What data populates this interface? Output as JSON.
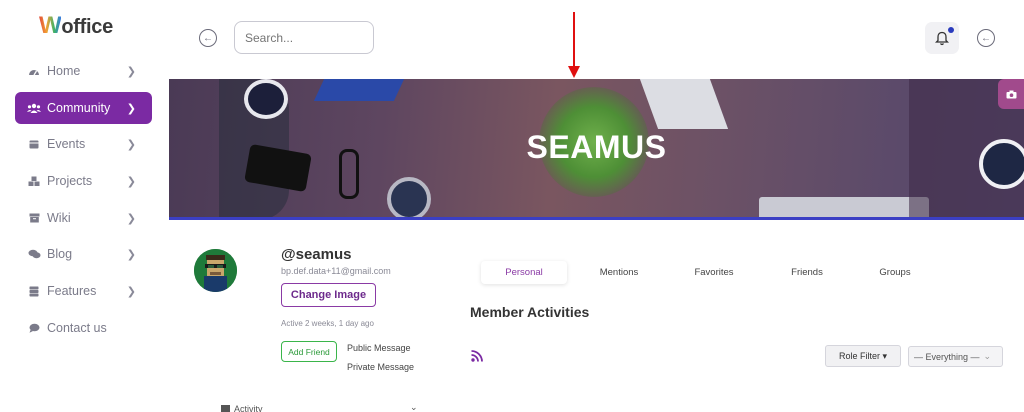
{
  "brand": {
    "logo_initial": "W",
    "logo_rest": "office"
  },
  "sidebar": {
    "items": [
      {
        "label": "Home",
        "icon": "dashboard-icon",
        "chevron": true,
        "active": false
      },
      {
        "label": "Community",
        "icon": "users-icon",
        "chevron": true,
        "active": true
      },
      {
        "label": "Events",
        "icon": "calendar-icon",
        "chevron": true,
        "active": false
      },
      {
        "label": "Projects",
        "icon": "cubes-icon",
        "chevron": true,
        "active": false
      },
      {
        "label": "Wiki",
        "icon": "box-icon",
        "chevron": true,
        "active": false
      },
      {
        "label": "Blog",
        "icon": "comments-icon",
        "chevron": true,
        "active": false
      },
      {
        "label": "Features",
        "icon": "server-icon",
        "chevron": true,
        "active": false
      },
      {
        "label": "Contact us",
        "icon": "comment-icon",
        "chevron": false,
        "active": false
      }
    ]
  },
  "header": {
    "search_placeholder": "Search...",
    "notifications_icon": "bell-icon",
    "back_icon": "arrow-left-icon"
  },
  "cover": {
    "title": "SEAMUS",
    "camera_icon": "camera-icon"
  },
  "profile": {
    "username": "@seamus",
    "email": "bp.def.data+11@gmail.com",
    "change_image_label": "Change Image",
    "active_text": "Active 2 weeks, 1 day ago",
    "add_friend_label": "Add Friend",
    "public_message_label": "Public Message",
    "private_message_label": "Private Message",
    "activity_label": "Activity"
  },
  "tabs": [
    {
      "label": "Personal",
      "active": true
    },
    {
      "label": "Mentions",
      "active": false
    },
    {
      "label": "Favorites",
      "active": false
    },
    {
      "label": "Friends",
      "active": false
    },
    {
      "label": "Groups",
      "active": false
    }
  ],
  "activities": {
    "title": "Member Activities",
    "rss_icon": "rss-icon",
    "role_filter_label": "Role Filter",
    "everything_label": "— Everything —"
  },
  "colors": {
    "accent": "#7b2aa3",
    "cover_underline": "#3b3fc4",
    "friend_green": "#3ab54a",
    "annotation_arrow": "#e01010"
  }
}
